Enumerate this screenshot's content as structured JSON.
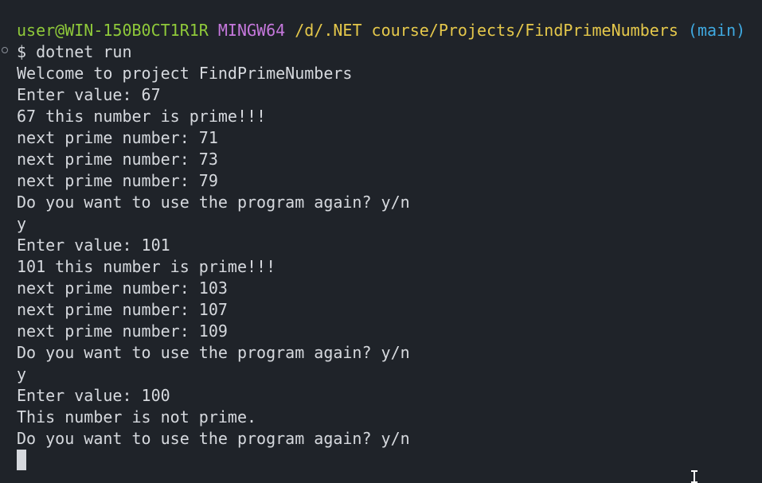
{
  "prompt": {
    "user": "user@WIN-150B0CT1R1R",
    "mingw": "MINGW64",
    "path": "/d/.NET course/Projects/FindPrimeNumbers",
    "branch": "(main)"
  },
  "command": "$ dotnet run",
  "output": [
    "Welcome to project FindPrimeNumbers",
    "Enter value: 67",
    "67 this number is prime!!!",
    "next prime number: 71",
    "next prime number: 73",
    "next prime number: 79",
    "Do you want to use the program again? y/n",
    "y",
    "Enter value: 101",
    "101 this number is prime!!!",
    "next prime number: 103",
    "next prime number: 107",
    "next prime number: 109",
    "Do you want to use the program again? y/n",
    "y",
    "Enter value: 100",
    "This number is not prime.",
    "Do you want to use the program again? y/n"
  ],
  "colors": {
    "background": "#1f2329",
    "text": "#d6d9de",
    "user": "#8fc93a",
    "mingw": "#c678dd",
    "path": "#e5c84b",
    "branch": "#3fa9e0"
  }
}
